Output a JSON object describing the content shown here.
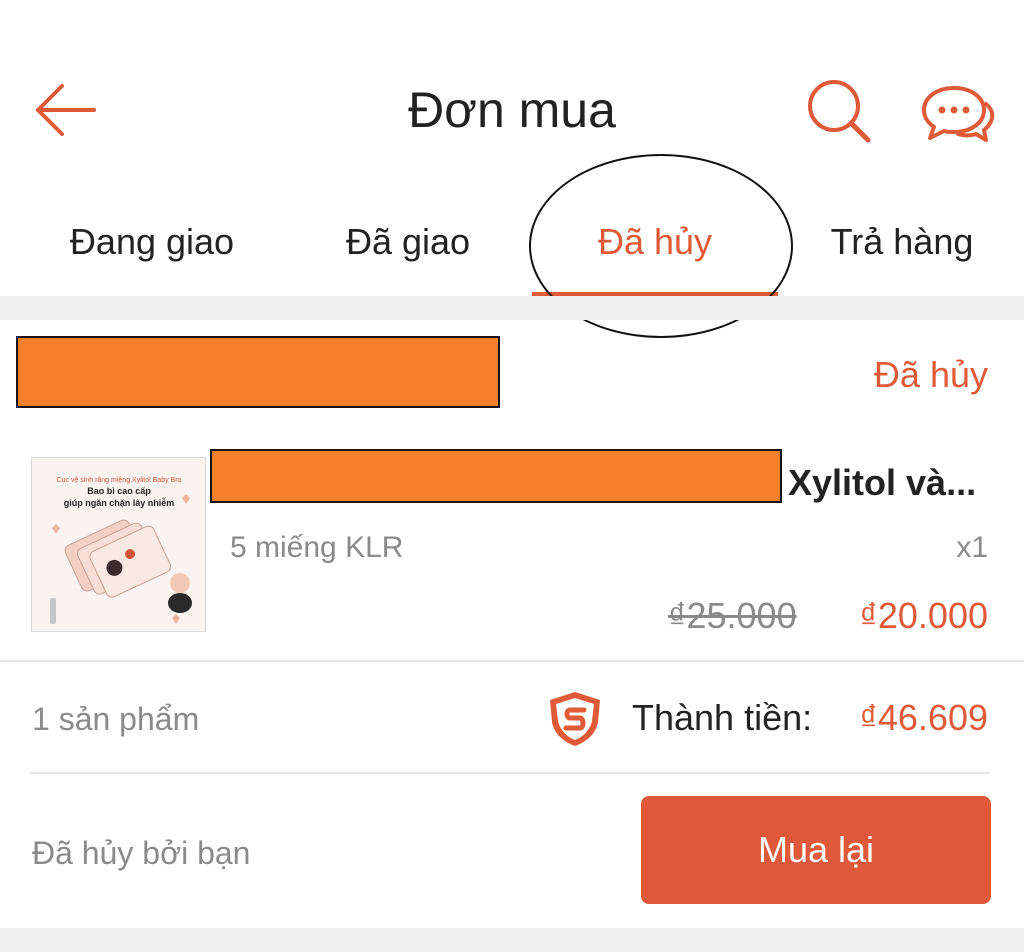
{
  "header": {
    "title": "Đơn mua",
    "back_icon": "arrow-left-icon",
    "search_icon": "search-icon",
    "chat_icon": "chat-bubbles-icon",
    "accent_color": "#e05a37"
  },
  "tabs": [
    {
      "label": "Đang giao",
      "active": false
    },
    {
      "label": "Đã giao",
      "active": false
    },
    {
      "label": "Đã hủy",
      "active": true
    },
    {
      "label": "Trả hàng",
      "active": false
    }
  ],
  "order": {
    "status": "Đã hủy",
    "product": {
      "name_visible": "Xylitol và...",
      "variant": "5 miếng KLR",
      "quantity": "x1",
      "original_price": "₫25.000",
      "price": "₫20.000",
      "image_text": {
        "line1": "Cục vệ sinh răng miệng Xylitol Baby Bro",
        "line2": "Bao bì cao cấp",
        "line3": "giúp ngăn chặn lây nhiễm"
      }
    },
    "summary": {
      "count": "1 sản phẩm",
      "total_label": "Thành tiền:",
      "total": "₫46.609",
      "shield_icon": "shield-s-icon"
    },
    "cancel_note": "Đã hủy bởi bạn",
    "buy_again_label": "Mua lại"
  }
}
